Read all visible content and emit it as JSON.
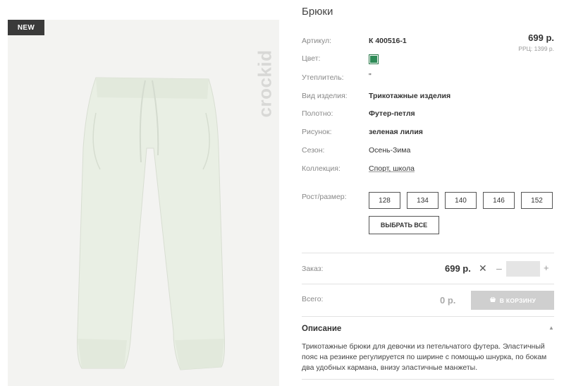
{
  "badge": "NEW",
  "brand": "crockid",
  "product": {
    "title": "Брюки",
    "price": "699 р.",
    "rrc": "РРЦ: 1399 р."
  },
  "attributes": {
    "article": {
      "label": "Артикул:",
      "value": "К 400516-1"
    },
    "color": {
      "label": "Цвет:",
      "swatch": "#2e8b57"
    },
    "insulation": {
      "label": "Утеплитель:",
      "value": "\""
    },
    "type": {
      "label": "Вид изделия:",
      "value": "Трикотажные изделия"
    },
    "fabric": {
      "label": "Полотно:",
      "value": "Футер-петля"
    },
    "pattern": {
      "label": "Рисунок:",
      "value": "зеленая лилия"
    },
    "season": {
      "label": "Сезон:",
      "value": "Осень-Зима"
    },
    "collection": {
      "label": "Коллекция:",
      "value": "Спорт, школа"
    }
  },
  "sizes": {
    "label": "Рост/размер:",
    "options": [
      "128",
      "134",
      "140",
      "146",
      "152"
    ],
    "select_all": "ВЫБРАТЬ ВСЕ"
  },
  "order": {
    "label": "Заказ:",
    "price": "699 р.",
    "times": "✕",
    "minus": "–",
    "plus": "+",
    "quantity": ""
  },
  "total": {
    "label": "Всего:",
    "value": "0 р.",
    "cart_button": "В КОРЗИНУ"
  },
  "description": {
    "title": "Описание",
    "text": "Трикотажные брюки для девочки из петельчатого футера. Эластичный пояс на резинке регулируется по ширине с помощью шнурка, по бокам два удобных кармана, внизу эластичные манжеты."
  },
  "colors": {
    "photo_bg": "#f3f3f1",
    "pants": "#e9efe4",
    "badge_bg": "#3a3a3a",
    "cart_disabled": "#cfcfcf"
  }
}
